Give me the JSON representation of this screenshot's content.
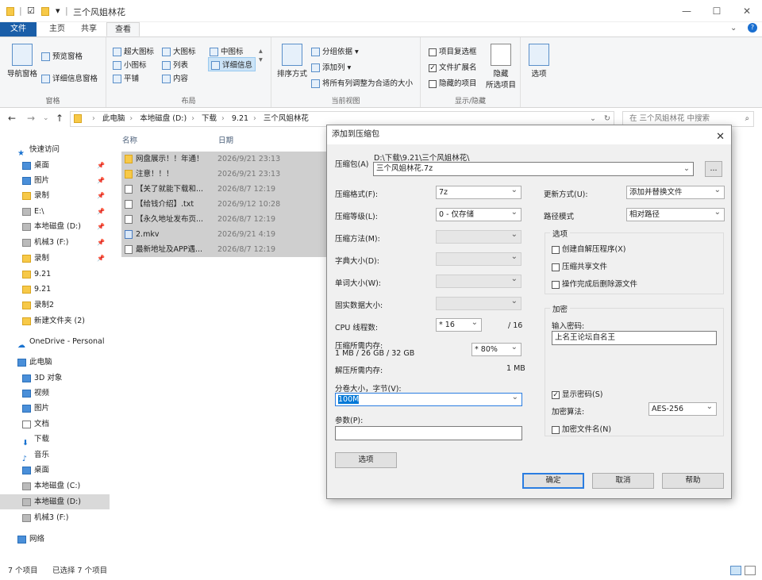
{
  "titlebar": {
    "title": "三个风姐林花",
    "min": "—",
    "max": "☐",
    "close": "✕"
  },
  "ribbon": {
    "tabs": [
      "文件",
      "主页",
      "共享",
      "查看"
    ],
    "panes": {
      "nav_pane": "导航窗格",
      "preview": "预览窗格",
      "details": "详细信息窗格",
      "label": "窗格"
    },
    "layout": {
      "items": [
        "超大图标",
        "大图标",
        "中图标",
        "小图标",
        "列表",
        "详细信息",
        "平铺",
        "内容"
      ],
      "label": "布局"
    },
    "current_view": {
      "sort": "排序方式",
      "group": "分组依据 ▾",
      "add_col": "添加列 ▾",
      "fit_cols": "将所有列调整为合适的大小",
      "label": "当前视图"
    },
    "show_hide": {
      "item_check": "项目复选框",
      "file_ext": "文件扩展名",
      "hidden_items": "隐藏的项目",
      "hide_selected": "隐藏",
      "hide_selected2": "所选项目",
      "label": "显示/隐藏"
    },
    "options": "选项"
  },
  "address": {
    "crumbs": [
      "此电脑",
      "本地磁盘 (D:)",
      "下载",
      "9.21",
      "三个风姐林花"
    ],
    "search_placeholder": "在 三个风姐林花 中搜索"
  },
  "nav": {
    "items": [
      {
        "label": "快速访问",
        "pin": ""
      },
      {
        "label": "桌面",
        "pin": "📌"
      },
      {
        "label": "图片",
        "pin": "📌"
      },
      {
        "label": "录制",
        "pin": "📌"
      },
      {
        "label": "E:\\",
        "pin": "📌"
      },
      {
        "label": "本地磁盘 (D:)",
        "pin": "📌"
      },
      {
        "label": "机械3 (F:)",
        "pin": "📌"
      },
      {
        "label": "录制",
        "pin": "📌"
      },
      {
        "label": "9.21",
        "pin": ""
      },
      {
        "label": "9.21",
        "pin": ""
      },
      {
        "label": "录制2",
        "pin": ""
      },
      {
        "label": "新建文件夹 (2)",
        "pin": ""
      },
      {
        "label": "OneDrive - Personal",
        "pin": ""
      },
      {
        "label": "此电脑",
        "pin": ""
      },
      {
        "label": "3D 对象",
        "pin": ""
      },
      {
        "label": "视频",
        "pin": ""
      },
      {
        "label": "图片",
        "pin": ""
      },
      {
        "label": "文档",
        "pin": ""
      },
      {
        "label": "下载",
        "pin": ""
      },
      {
        "label": "音乐",
        "pin": ""
      },
      {
        "label": "桌面",
        "pin": ""
      },
      {
        "label": "本地磁盘 (C:)",
        "pin": ""
      },
      {
        "label": "本地磁盘 (D:)",
        "pin": ""
      },
      {
        "label": "机械3 (F:)",
        "pin": ""
      },
      {
        "label": "网络",
        "pin": ""
      }
    ]
  },
  "files": {
    "col_name": "名称",
    "col_date": "日期",
    "rows": [
      {
        "name": "网盘展示！！年通！",
        "date": "2026/9/21 23:13"
      },
      {
        "name": "注意！！！",
        "date": "2026/9/21 23:13"
      },
      {
        "name": "【关了就能下载和...",
        "date": "2026/8/7 12:19"
      },
      {
        "name": "【给钱介绍】.txt",
        "date": "2026/9/12 10:28"
      },
      {
        "name": "【永久地址发布页...",
        "date": "2026/8/7 12:19"
      },
      {
        "name": "2.mkv",
        "date": "2026/9/21 4:19"
      },
      {
        "name": "最新地址及APP遇...",
        "date": "2026/8/7 12:19"
      }
    ]
  },
  "status": {
    "count": "7 个项目",
    "selected": "已选择 7 个项目"
  },
  "dialog": {
    "title": "添加到压缩包",
    "archive_label": "压缩包(A)",
    "archive_path": "D:\\下载\\9.21\\三个风姐林花\\",
    "archive_name": "三个风姐林花.7z",
    "browse": "...",
    "format_label": "压缩格式(F):",
    "format": "7z",
    "level_label": "压缩等级(L):",
    "level": "0 - 仅存储",
    "method_label": "压缩方法(M):",
    "dict_label": "字典大小(D):",
    "word_label": "单词大小(W):",
    "solid_label": "固实数据大小:",
    "cpu_label": "CPU 线程数:",
    "cpu": "* 16",
    "cpu_total": "/ 16",
    "mem_label": "压缩所需内存:",
    "mem_value": "1 MB / 26 GB / 32 GB",
    "mem_pct": "* 80%",
    "demem_label": "解压所需内存:",
    "demem_value": "1 MB",
    "split_label": "分卷大小，字节(V):",
    "split": "100M",
    "params_label": "参数(P):",
    "options_btn": "选项",
    "update_label": "更新方式(U):",
    "update": "添加并替换文件",
    "path_label": "路径模式",
    "path": "相对路径",
    "opt_group": "选项",
    "opt_sfx": "创建自解压程序(X)",
    "opt_shared": "压缩共享文件",
    "opt_delete": "操作完成后删除源文件",
    "enc_group": "加密",
    "pwd_label": "输入密码:",
    "pwd": "上名王论坛自名王",
    "show_pwd": "显示密码(S)",
    "enc_method_label": "加密算法:",
    "enc_method": "AES-256",
    "enc_names": "加密文件名(N)",
    "ok": "确定",
    "cancel": "取消",
    "help": "帮助",
    "close": "✕"
  }
}
